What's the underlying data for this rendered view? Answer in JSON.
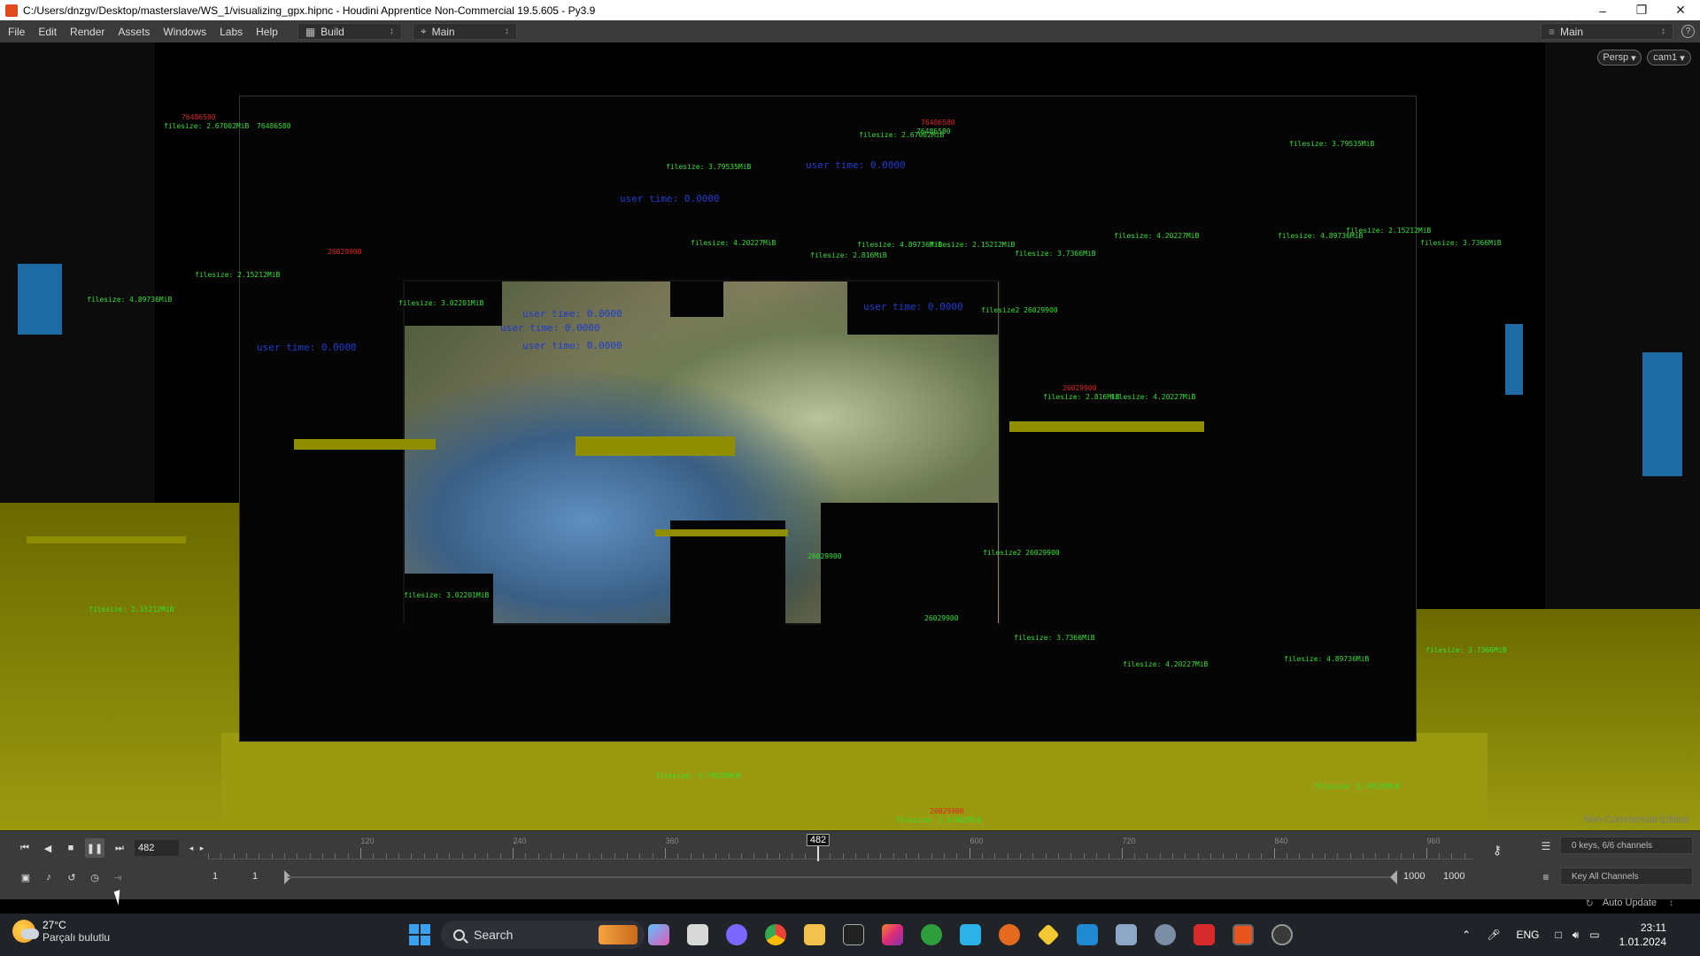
{
  "window": {
    "title": "C:/Users/dnzgv/Desktop/masterslave/WS_1/visualizing_gpx.hipnc - Houdini Apprentice Non-Commercial 19.5.605 - Py3.9",
    "controls": [
      "minimize-icon",
      "restore-icon",
      "close-icon"
    ]
  },
  "menubar": {
    "items": [
      "File",
      "Edit",
      "Render",
      "Assets",
      "Windows",
      "Labs",
      "Help"
    ],
    "desktop_selector": "Build",
    "pane_tab_selector": "Main",
    "right_selector": "Main"
  },
  "viewport": {
    "camera_view": "Persp",
    "camera": "cam1",
    "watermark": "Non-Commercial Edition",
    "overlay_labels": {
      "filesize_a": "filesize: 2.67002MiB",
      "filesize_b": "filesize: 3.79535MiB",
      "filesize_c": "filesize: 4.89736MiB",
      "filesize_d": "filesize: 2.15212MiB",
      "filesize_e": "filesize: 3.7366MiB",
      "filesize_f": "filesize: 4.20227MiB",
      "filesize_g": "filesize: 2.816MiB",
      "filesize_h": "filesize: 3.02201MiB",
      "filesize_i": "filesize2 26029900",
      "user_time_a": "user time: 0.0000",
      "user_time_b": "user time: 0.0000",
      "number_a": "76486580",
      "number_b": "26029900"
    }
  },
  "timeline": {
    "current_frame": "482",
    "cursor_label": "482",
    "ruler_labels": [
      "120",
      "240",
      "360",
      "480",
      "600",
      "720",
      "840",
      "960"
    ],
    "start_frame": "1",
    "range_start": "1",
    "range_end": "1000",
    "end_frame": "1000",
    "keys_info": "0 keys, 6/6 channels",
    "key_all": "Key All Channels",
    "auto_update": "Auto Update"
  },
  "taskbar": {
    "weather_temp": "27°C",
    "weather_desc": "Parçalı bulutlu",
    "search_placeholder": "Search",
    "language": "ENG",
    "time": "23:11",
    "date": "1.01.2024"
  },
  "colors": {
    "overlay_red": "#e02020",
    "overlay_green": "#30e030",
    "overlay_blue": "#1e3cd0",
    "floor_yellow": "#9a9a10",
    "accent_blue": "#3aa0f0"
  }
}
